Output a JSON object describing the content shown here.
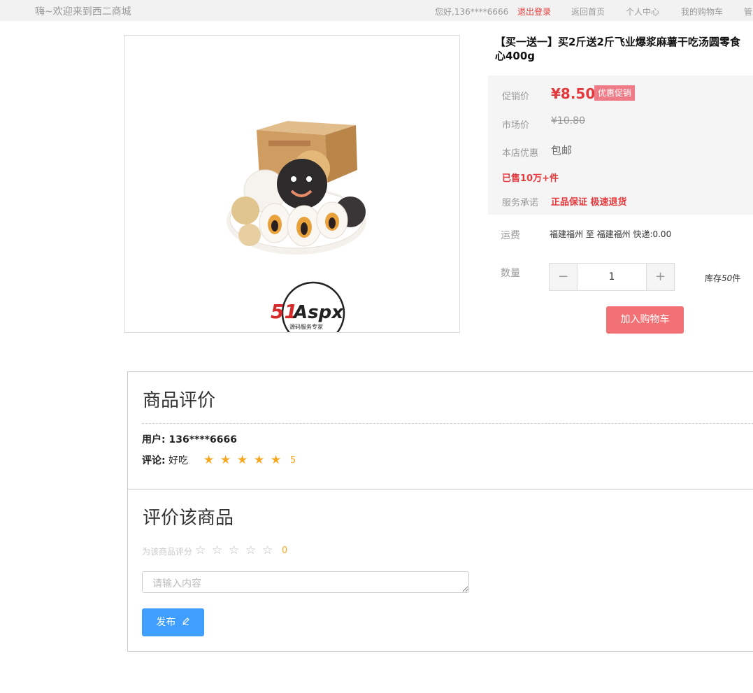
{
  "topbar": {
    "welcome": "嗨~欢迎来到西二商城",
    "greeting": "您好,136****6666",
    "logout": "退出登录",
    "nav": [
      "返回首页",
      "个人中心",
      "我的购物车",
      "管"
    ]
  },
  "product": {
    "title_line1": "【买一送一】买2斤送2斤飞业爆浆麻薯干吃汤圆零食",
    "title_line2": "心400g",
    "promo_label": "促销价",
    "promo_price": "¥8.50",
    "promo_badge": "优惠促销",
    "market_label": "市场价",
    "market_price": "¥10.80",
    "offer_label": "本店优惠",
    "offer_value": "包邮",
    "sold": "已售10万+件",
    "service_label": "服务承诺",
    "service_value": "正品保证 极速退货",
    "freight_label": "运费",
    "freight_text": "福建福州  至  福建福州   快递:0.00",
    "qty_label": "数量",
    "qty_value": "1",
    "stock_prefix": "库存",
    "stock_count": "50",
    "stock_suffix": "件",
    "add_cart": "加入购物车",
    "watermark_text": "51Aspx",
    "watermark_sub": "源码服务专家"
  },
  "reviews": {
    "title": "商品评价",
    "user_line": "用户: 136****6666",
    "comment_label": "评论:",
    "comment_text": " 好吃",
    "rating": "5",
    "rating_value": 5
  },
  "review_form": {
    "title": "评价该商品",
    "rate_label": "为该商品评分",
    "rating": "0",
    "placeholder": "请输入内容",
    "publish": "发布"
  }
}
